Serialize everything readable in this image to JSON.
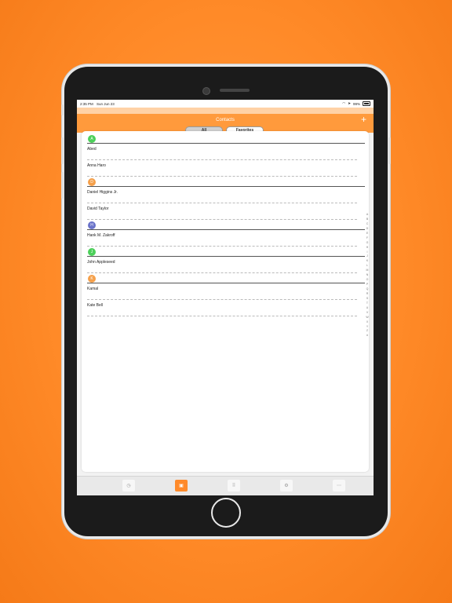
{
  "status": {
    "time": "2:35 PM",
    "date": "Sun Jun 23",
    "battery": "99%"
  },
  "nav": {
    "title": "Contacts",
    "add_label": "+"
  },
  "segments": {
    "all": "All",
    "favorites": "Favorites"
  },
  "sections": [
    {
      "letter": "A",
      "color": "#4cd05a",
      "contacts": [
        "Abed",
        "Anna Haro"
      ]
    },
    {
      "letter": "D",
      "color": "#f5a04a",
      "contacts": [
        "Daniel Higgins Jr.",
        "David Taylor"
      ]
    },
    {
      "letter": "H",
      "color": "#6a73c9",
      "contacts": [
        "Hank M. Zakroff"
      ]
    },
    {
      "letter": "J",
      "color": "#4cd05a",
      "contacts": [
        "John Appleseed"
      ]
    },
    {
      "letter": "K",
      "color": "#f5a04a",
      "contacts": [
        "Kamal",
        "Kate Bell"
      ]
    }
  ],
  "index_letters": [
    "A",
    "B",
    "C",
    "D",
    "E",
    "F",
    "G",
    "H",
    "I",
    "J",
    "K",
    "L",
    "M",
    "N",
    "O",
    "P",
    "Q",
    "R",
    "S",
    "T",
    "U",
    "V",
    "W",
    "X",
    "Y",
    "Z",
    "#"
  ],
  "tabs": [
    {
      "name": "tab-recents",
      "icon": "clock-icon"
    },
    {
      "name": "tab-contacts",
      "icon": "contacts-book-icon"
    },
    {
      "name": "tab-keypad",
      "icon": "keypad-icon"
    },
    {
      "name": "tab-settings",
      "icon": "settings-icon"
    },
    {
      "name": "tab-more",
      "icon": "more-icon"
    }
  ],
  "colors": {
    "accent": "#ff9a3c",
    "background": "#ff8a28"
  }
}
